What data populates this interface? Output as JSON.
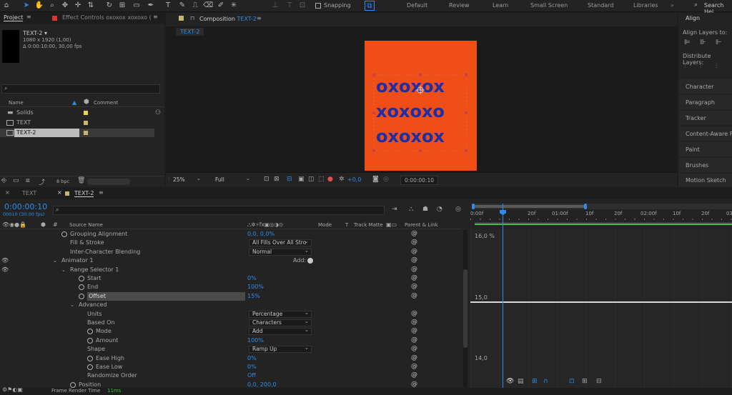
{
  "toolbar": {
    "snapping_label": "Snapping",
    "workspaces": [
      "Default",
      "Review",
      "Learn",
      "Small Screen",
      "Standard",
      "Libraries"
    ],
    "search_placeholder": "Search Hel"
  },
  "project": {
    "tab_project": "Project",
    "tab_effects": "Effect Controls oxoxox xoxoxo (",
    "comp_name": "TEXT-2 ▾",
    "comp_size": "1080 x 1920 (1,00)",
    "comp_duration": "Δ 0:00:10:00, 30,00 fps",
    "col_name": "Name",
    "col_comment": "Comment",
    "items": [
      {
        "name": "Solids",
        "color": "#e6d44c"
      },
      {
        "name": "TEXT",
        "color": "#c8b46e"
      },
      {
        "name": "TEXT-2",
        "color": "#c8b46e"
      }
    ],
    "bpc": "8 bpc"
  },
  "composition": {
    "tab_label": "Composition",
    "tab_name": "TEXT-2",
    "breadcrumb": "TEXT-2",
    "lines": [
      "oxoxox",
      "xoxoxo",
      "oxoxox"
    ],
    "bg_color": "#f04e17",
    "text_color": "#1b2fa6",
    "zoom": "25%",
    "quality": "Full",
    "exposure": "+0,0",
    "timecode": "0:00:00:10"
  },
  "right": {
    "align_title": "Align",
    "align_layers_to": "Align Layers to:",
    "distribute_layers": "Distribute Layers:",
    "panels": [
      "Character",
      "Paragraph",
      "Tracker",
      "Content-Aware Fil",
      "Paint",
      "Brushes",
      "Motion Sketch"
    ]
  },
  "timeline": {
    "tab_text": "TEXT",
    "tab_text2": "TEXT-2",
    "timecode": "0:00:00:10",
    "fps": "00010 (30.00 fps)",
    "col_source": "Source Name",
    "col_mode": "Mode",
    "col_t": "T",
    "col_trackmatte": "Track Matte",
    "col_parent": "Parent & Link",
    "add_label": "Add:",
    "props": [
      {
        "label": "Grouping Alignment",
        "indent": 98,
        "stop": true,
        "value": "0,0, 0,0%",
        "kind": "val"
      },
      {
        "label": "Fill & Stroke",
        "indent": 98,
        "value": "All Fills Over All Stro",
        "kind": "drop"
      },
      {
        "label": "Inter-Character Blending",
        "indent": 98,
        "value": "Normal",
        "kind": "drop"
      },
      {
        "label": "Animator 1",
        "indent": 86,
        "twirl": true,
        "eye": true,
        "kind": "add"
      },
      {
        "label": "Range Selector 1",
        "indent": 98,
        "twirl": true,
        "eye": true,
        "kind": "none"
      },
      {
        "label": "Start",
        "indent": 122,
        "stop": true,
        "value": "0%",
        "kind": "val"
      },
      {
        "label": "End",
        "indent": 122,
        "stop": true,
        "value": "100%",
        "kind": "val"
      },
      {
        "label": "Offset",
        "indent": 122,
        "stop": true,
        "value": "15%",
        "kind": "val",
        "selected": true
      },
      {
        "label": "Advanced",
        "indent": 110,
        "twirl": true,
        "kind": "none"
      },
      {
        "label": "Units",
        "indent": 122,
        "value": "Percentage",
        "kind": "drop"
      },
      {
        "label": "Based On",
        "indent": 122,
        "value": "Characters",
        "kind": "drop"
      },
      {
        "label": "Mode",
        "indent": 134,
        "stop": true,
        "value": "Add",
        "kind": "drop"
      },
      {
        "label": "Amount",
        "indent": 134,
        "stop": true,
        "value": "100%",
        "kind": "val"
      },
      {
        "label": "Shape",
        "indent": 122,
        "value": "Ramp Up",
        "kind": "drop"
      },
      {
        "label": "Ease High",
        "indent": 134,
        "stop": true,
        "value": "0%",
        "kind": "val"
      },
      {
        "label": "Ease Low",
        "indent": 134,
        "stop": true,
        "value": "0%",
        "kind": "val"
      },
      {
        "label": "Randomize Order",
        "indent": 122,
        "value": "Off",
        "kind": "val"
      },
      {
        "label": "Position",
        "indent": 110,
        "stop": true,
        "value": "0,0, 200,0",
        "kind": "val"
      }
    ],
    "ruler": [
      "0:00f",
      "",
      "20f",
      "01:00f",
      "10f",
      "20f",
      "02:00f",
      "10f",
      "20f",
      "03"
    ],
    "graph_labels": [
      "16,0 %",
      "15,0",
      "14,0"
    ],
    "render_time_label": "Frame Render Time",
    "render_time_value": "11ms"
  }
}
